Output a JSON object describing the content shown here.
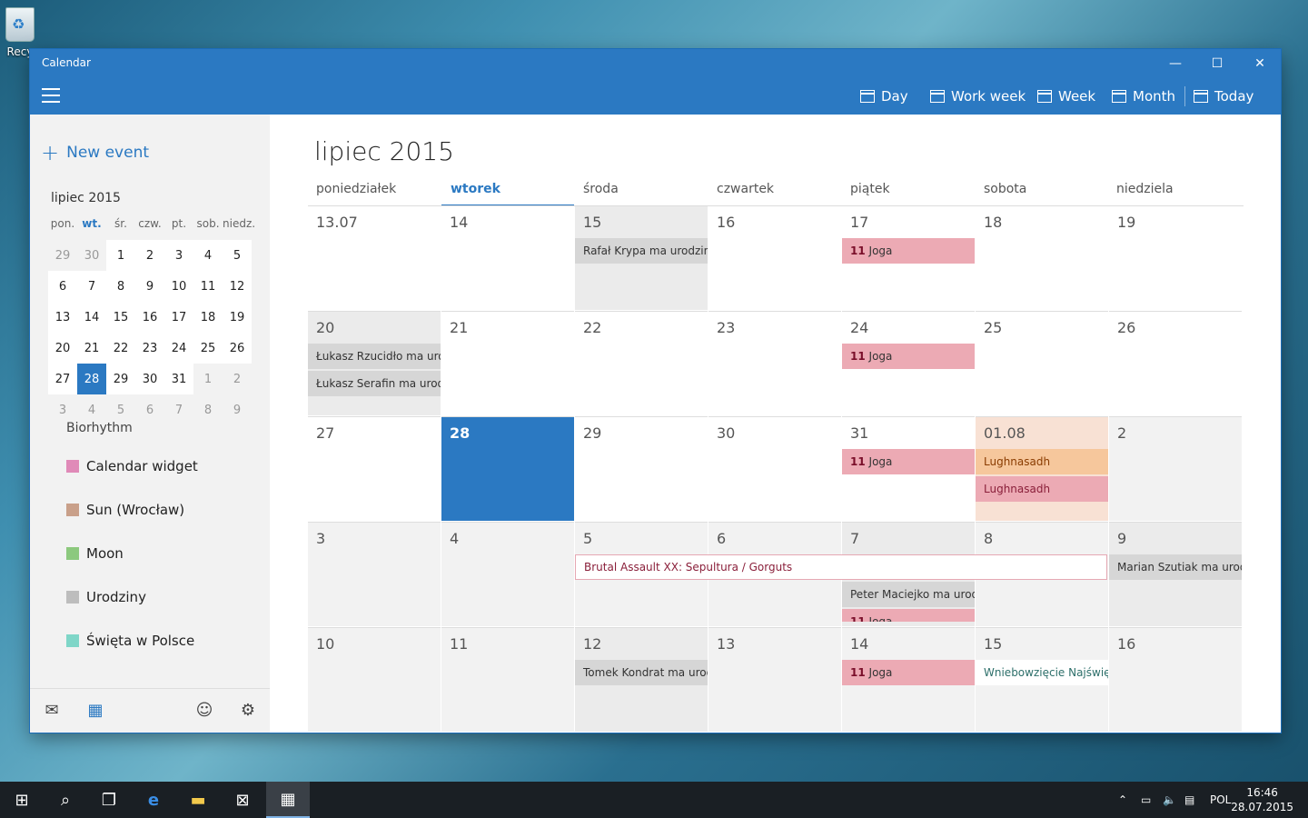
{
  "desktop": {
    "recycle_bin_label": "Recy"
  },
  "window": {
    "title": "Calendar",
    "controls": {
      "minimize": "—",
      "maximize": "☐",
      "close": "✕"
    }
  },
  "toolbar": {
    "day": "Day",
    "work_week": "Work week",
    "week": "Week",
    "month": "Month",
    "today": "Today"
  },
  "sidebar": {
    "new_event": "New event",
    "mini_month_title": "lipiec 2015",
    "mini_weekdays": [
      "pon.",
      "wt.",
      "śr.",
      "czw.",
      "pt.",
      "sob.",
      "niedz."
    ],
    "mini_days": [
      [
        "29",
        "30",
        "1",
        "2",
        "3",
        "4",
        "5"
      ],
      [
        "6",
        "7",
        "8",
        "9",
        "10",
        "11",
        "12"
      ],
      [
        "13",
        "14",
        "15",
        "16",
        "17",
        "18",
        "19"
      ],
      [
        "20",
        "21",
        "22",
        "23",
        "24",
        "25",
        "26"
      ],
      [
        "27",
        "28",
        "29",
        "30",
        "31",
        "1",
        "2"
      ],
      [
        "3",
        "4",
        "5",
        "6",
        "7",
        "8",
        "9"
      ]
    ],
    "cut_item": "Biorhythm",
    "calendars": [
      {
        "name": "Calendar widget",
        "color": "#e08ab8"
      },
      {
        "name": "Sun (Wrocław)",
        "color": "#c9a08a"
      },
      {
        "name": "Moon",
        "color": "#8cc97e"
      },
      {
        "name": "Urodziny",
        "color": "#bdbdbd"
      },
      {
        "name": "Święta w Polsce",
        "color": "#7fd6c8"
      }
    ]
  },
  "main": {
    "month_title": "lipiec 2015",
    "weekdays": [
      "poniedziałek",
      "wtorek",
      "środa",
      "czwartek",
      "piątek",
      "sobota",
      "niedziela"
    ],
    "weeks": [
      [
        "13.07",
        "14",
        "15",
        "16",
        "17",
        "18",
        "19"
      ],
      [
        "20",
        "21",
        "22",
        "23",
        "24",
        "25",
        "26"
      ],
      [
        "27",
        "28",
        "29",
        "30",
        "31",
        "01.08",
        "2"
      ],
      [
        "3",
        "4",
        "5",
        "6",
        "7",
        "8",
        "9"
      ],
      [
        "10",
        "11",
        "12",
        "13",
        "14",
        "15",
        "16"
      ]
    ],
    "events": {
      "w0_d2": "Rafał Krypa ma urodziny",
      "joga_time": "11",
      "joga_title": "Joga",
      "w1_d0_a": "Łukasz Rzucidło ma urodziny",
      "w1_d0_b": "Łukasz Serafin ma urodziny",
      "w2_d5_a": "Lughnasadh",
      "w2_d5_b": "Lughnasadh",
      "w3_span": "Brutal Assault XX: Sepultura / Gorguts",
      "w3_d6": "Marian Szutiak ma urodziny",
      "w3_d4": "Peter Maciejko ma urodziny",
      "w4_d2": "Tomek Kondrat ma urodziny",
      "w4_d5": "Wniebowzięcie Najświętszej Maryi Panny"
    }
  },
  "taskbar": {
    "language": "POL",
    "time": "16:46",
    "date": "28.07.2015"
  }
}
